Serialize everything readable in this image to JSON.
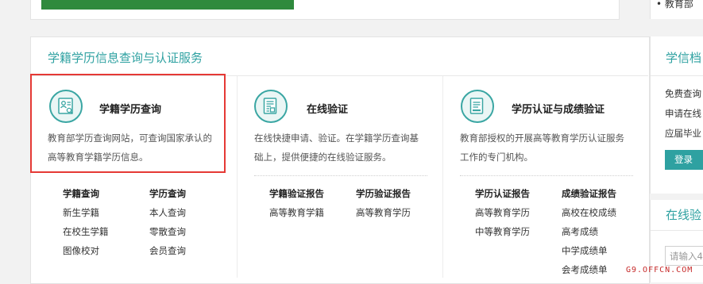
{
  "top": {
    "right_text": "• 教育部"
  },
  "section_title": "学籍学历信息查询与认证服务",
  "services": [
    {
      "title": "学籍学历查询",
      "desc_line1": "教育部学历查询网站，可查询国家承认的",
      "desc_line2": "高等教育学籍学历信息。",
      "groups": [
        {
          "head": "学籍查询",
          "links": [
            "新生学籍",
            "在校生学籍",
            "图像校对"
          ]
        },
        {
          "head": "学历查询",
          "links": [
            "本人查询",
            "零散查询",
            "会员查询"
          ]
        }
      ]
    },
    {
      "title": "在线验证",
      "desc_line1": "在线快捷申请、验证。在学籍学历查询基",
      "desc_line2": "础上，提供便捷的在线验证服务。",
      "groups": [
        {
          "head": "学籍验证报告",
          "links": [
            "高等教育学籍"
          ]
        },
        {
          "head": "学历验证报告",
          "links": [
            "高等教育学历"
          ]
        }
      ]
    },
    {
      "title": "学历认证与成绩验证",
      "desc_line1": "教育部授权的开展高等教育学历认证服务",
      "desc_line2": "工作的专门机构。",
      "groups": [
        {
          "head": "学历认证报告",
          "links": [
            "高等教育学历",
            "中等教育学历"
          ]
        },
        {
          "head": "成绩验证报告",
          "links": [
            "高校在校成绩",
            "高考成绩",
            "中学成绩单",
            "会考成绩单"
          ]
        }
      ]
    }
  ],
  "side": {
    "title": "学信档",
    "lines": [
      "免费查询",
      "申请在线",
      "应届毕业"
    ],
    "button": "登录",
    "title2": "在线验",
    "input_placeholder": "请输入4"
  },
  "watermark": "G9.OFFCN.COM"
}
